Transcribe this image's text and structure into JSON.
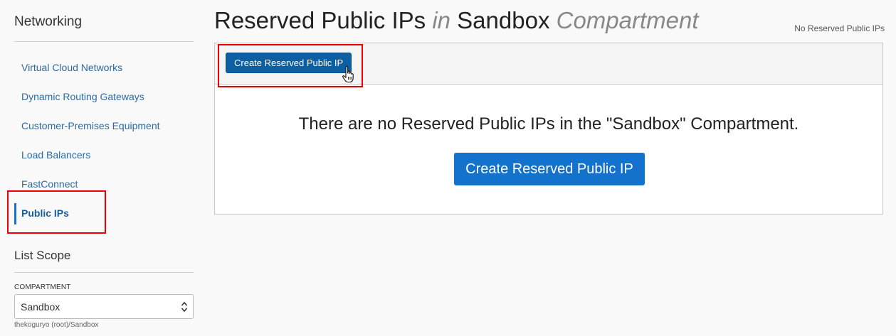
{
  "sidebar": {
    "title": "Networking",
    "items": [
      {
        "label": "Virtual Cloud Networks"
      },
      {
        "label": "Dynamic Routing Gateways"
      },
      {
        "label": "Customer-Premises Equipment"
      },
      {
        "label": "Load Balancers"
      },
      {
        "label": "FastConnect"
      },
      {
        "label": "Public IPs"
      }
    ],
    "active_item": "Public IPs",
    "scope": {
      "title": "List Scope",
      "compartment_label": "COMPARTMENT",
      "compartment_value": "Sandbox",
      "compartment_path": "thekoguryo (root)/Sandbox"
    }
  },
  "header": {
    "title_part1": "Reserved Public IPs",
    "title_in": "in",
    "title_compartment": "Sandbox",
    "title_suffix": "Compartment",
    "count_text": "No Reserved Public IPs"
  },
  "panel": {
    "toolbar_button_label": "Create Reserved Public IP",
    "empty_message": "There are no Reserved Public IPs in the \"Sandbox\" Compartment.",
    "empty_button_label": "Create Reserved Public IP"
  },
  "colors": {
    "highlight": "#ee0000",
    "primary_button": "#0d5fa3",
    "cta_button": "#1372cc",
    "link": "#2b6aa8"
  }
}
